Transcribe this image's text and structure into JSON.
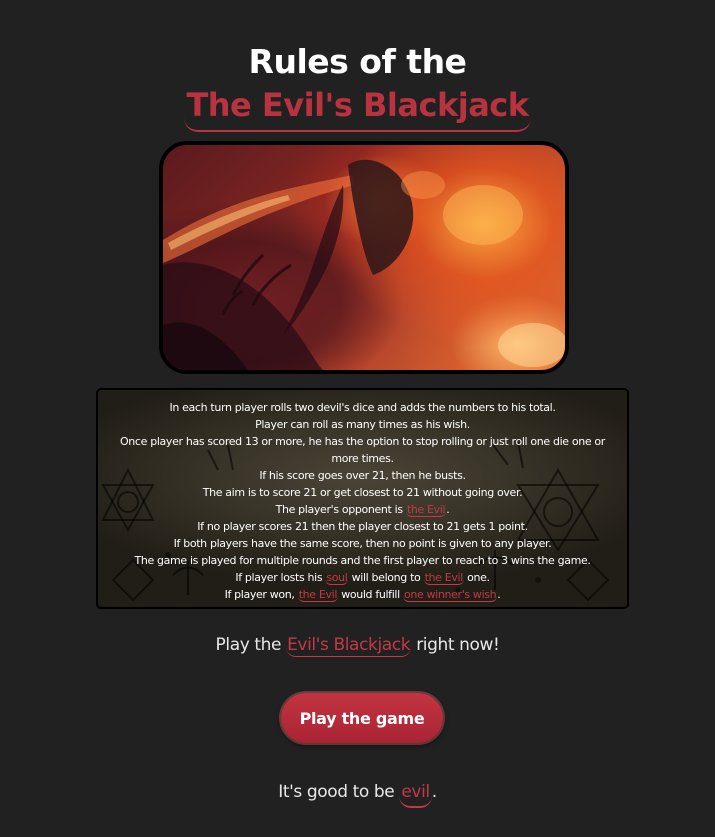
{
  "header": {
    "line1": "Rules of the",
    "line2": "The Evil's Blackjack"
  },
  "hero": {
    "image_icon": "fiery-demon-image"
  },
  "rules": {
    "l1": "In each turn player rolls two devil's dice and adds the numbers to his total.",
    "l2": "Player can roll as many times as his wish.",
    "l3": "Once player has scored 13 or more, he has the option to stop rolling or just roll one die one or",
    "l4": "more times.",
    "l5": "If his score goes over 21, then he busts.",
    "l6": "The aim is to score 21 or get closest to 21 without going over.",
    "l7_pre": "The player's opponent is",
    "l7_hl": "the Evil",
    "l7_post": ".",
    "l8": "If no player scores 21 then the player closest to 21 gets 1 point.",
    "l9": "If both players have the same score, then no point is given to any player.",
    "l10": "The game is played for multiple rounds and the first player to reach to 3 wins the game.",
    "l11_pre": "If player losts his",
    "l11_hl1": "soul",
    "l11_mid": "will belong to",
    "l11_hl2": "the Evil",
    "l11_post": "one.",
    "l12_pre": "If player won,",
    "l12_hl1": "the Evil",
    "l12_mid": "would fulfill",
    "l12_hl2": "one winner's wish",
    "l12_post": "."
  },
  "cta": {
    "pre": "Play the",
    "highlight": "Evil's Blackjack",
    "post": "right now!",
    "button_label": "Play the game"
  },
  "footer": {
    "pre": "It's good to be",
    "highlight": "evil",
    "post": "."
  },
  "colors": {
    "background": "#212121",
    "accent": "#b8323f",
    "button": "#c33442",
    "text": "#ffffff"
  }
}
